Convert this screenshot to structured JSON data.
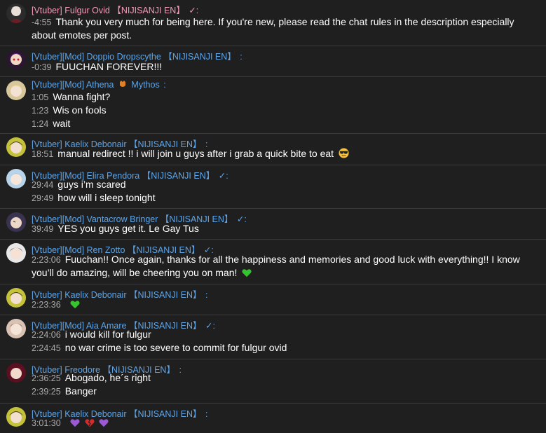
{
  "messages": [
    {
      "author": "[Vtuber] Fulgur Ovid",
      "tag": "【NIJISANJI EN】",
      "verified": "✓:",
      "lines": [
        {
          "time": "-4:55",
          "text": "Thank you very much for being here. If you're new, please read the chat rules in the description especially"
        },
        {
          "time": "",
          "text": "about emotes per post."
        }
      ]
    },
    {
      "author": "[Vtuber][Mod] Doppio Dropscythe",
      "tag": "【NIJISANJI EN】",
      "colon": ":",
      "lines": [
        {
          "time": "-0:39",
          "text": "FUUCHAN FOREVER!!!"
        }
      ]
    },
    {
      "author": "[Vtuber][Mod] Athena",
      "tag": "Mythos",
      "colon": ":",
      "lines": [
        {
          "time": "1:05",
          "text": "Wanna fight?"
        },
        {
          "time": "1:23",
          "text": "Wis on fools"
        },
        {
          "time": "1:24",
          "text": "wait"
        }
      ]
    },
    {
      "author": "[Vtuber] Kaelix Debonair",
      "tag": "【NIJISANJI EN】",
      "colon": ":",
      "lines": [
        {
          "time": "18:51",
          "text": "manual redirect !! i will join u guys after i grab a quick bite to eat"
        }
      ]
    },
    {
      "author": "[Vtuber][Mod] Elira Pendora",
      "tag": "【NIJISANJI EN】",
      "verified": "✓:",
      "lines": [
        {
          "time": "29:44",
          "text": "guys i’m scared"
        },
        {
          "time": "29:49",
          "text": "how will i sleep tonight"
        }
      ]
    },
    {
      "author": "[Vtuber][Mod] Vantacrow Bringer",
      "tag": "【NIJISANJI EN】",
      "verified": "✓:",
      "lines": [
        {
          "time": "39:49",
          "text": "YES you guys get it. Le Gay Tus"
        }
      ]
    },
    {
      "author": "[Vtuber][Mod] Ren Zotto",
      "tag": "【NIJISANJI EN】",
      "verified": "✓:",
      "lines": [
        {
          "time": "2:23:06",
          "text": "Fuuchan!! Once again, thanks for all the happiness and memories and good luck with everything!! I know"
        },
        {
          "time": "",
          "text": "you’ll do amazing, will be cheering you on man!"
        }
      ]
    },
    {
      "author": "[Vtuber] Kaelix Debonair",
      "tag": "【NIJISANJI EN】",
      "colon": ":",
      "lines": [
        {
          "time": "2:23:36",
          "text": ""
        }
      ]
    },
    {
      "author": "[Vtuber][Mod] Aia Amare",
      "tag": "【NIJISANJI EN】",
      "verified": "✓:",
      "lines": [
        {
          "time": "2:24:06",
          "text": "i would kill for fulgur"
        },
        {
          "time": "2:24:45",
          "text": "no war crime is too severe to commit for fulgur ovid"
        }
      ]
    },
    {
      "author": "[Vtuber] Freodore",
      "tag": "【NIJISANJI EN】",
      "colon": ":",
      "lines": [
        {
          "time": "2:36:25",
          "text": "Abogado, he´s right"
        },
        {
          "time": "2:39:25",
          "text": "Banger"
        }
      ]
    },
    {
      "author": "[Vtuber] Kaelix Debonair",
      "tag": "【NIJISANJI EN】",
      "colon": ":",
      "lines": [
        {
          "time": "3:01:30",
          "text": ""
        }
      ]
    }
  ],
  "emojis": {
    "sunglasses": "smiling-face-with-sunglasses",
    "green_heart": "green-heart",
    "purple_heart": "purple-heart",
    "broken_heart": "broken-heart"
  },
  "colors": {
    "background": "#1f1f1f",
    "name_blue": "#5ea5e8",
    "name_pink": "#f39bb6",
    "timestamp": "#aaaaaa",
    "divider": "#3a3a3a"
  }
}
